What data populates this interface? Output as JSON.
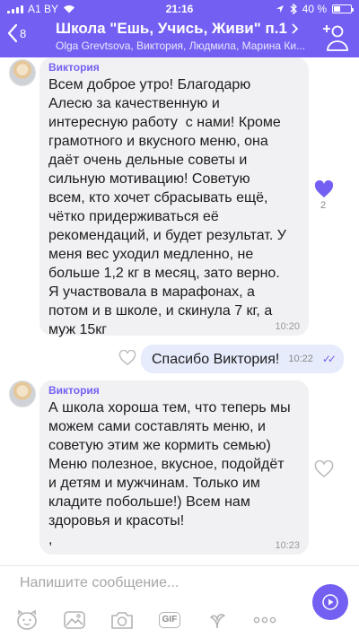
{
  "status_bar": {
    "carrier": "A1 BY",
    "time": "21:16",
    "battery_percent": "40 %",
    "battery_level": 0.4
  },
  "header": {
    "back_count": "8",
    "title": "Школа \"Ешь, Учись, Живи\" п.1",
    "subtitle": "Olga Grevtsova, Виктория, Людмила, Марина Ки..."
  },
  "messages": [
    {
      "sender": "Виктория",
      "text": "Всем доброе утро! Благодарю\nАлесю за качественную и\nинтересную работу  с нами! Кроме\nграмотного и вкусного меню, она\nдаёт очень дельные советы и\nсильную мотивацию! Советую\nвсем, кто хочет сбрасывать ещё,\nчётко придерживаться её\nрекомендаций, и будет результат. У\nменя вес уходил медленно, не\nбольше 1,2 кг в месяц, зато верно.\nЯ участвовала в марафонах, а\nпотом и в школе, и скинула 7 кг, а\nмуж 15кг",
      "time": "10:20",
      "likes": "2"
    },
    {
      "text": "Спасибо Виктория!",
      "time": "10:22"
    },
    {
      "sender": "Виктория",
      "text": "А школа хороша тем, что теперь мы\nможем сами составлять меню, и\nсоветую этим же кормить семью)\nМеню полезное, вкусное, подойдёт\nи детям и мужчинам. Только им\nкладите побольше!) Всем нам\nздоровья и красоты!\n,",
      "time": "10:23"
    }
  ],
  "input": {
    "placeholder": "Напишите сообщение..."
  },
  "toolbar": {
    "gif_label": "GIF"
  },
  "colors": {
    "accent": "#7360f2",
    "incoming_bubble": "#f1f1f4",
    "outgoing_bubble": "#e6ecfb"
  }
}
